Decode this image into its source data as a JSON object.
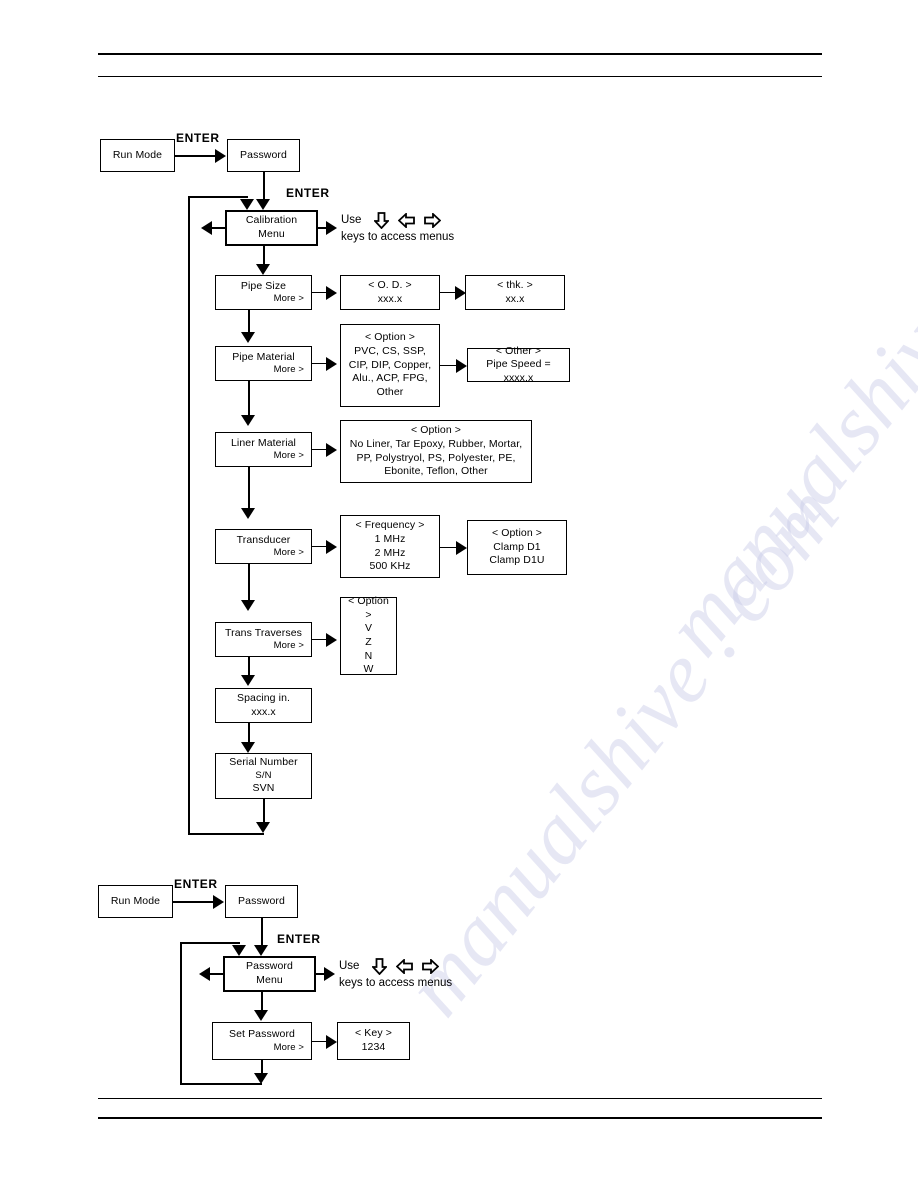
{
  "document": {
    "watermark_text": "manualshive . com"
  },
  "calibration_flow": {
    "run_mode": "Run Mode",
    "password": "Password",
    "enter_label_1": "ENTER",
    "enter_label_2": "ENTER",
    "menu_title_line1": "Calibration",
    "menu_title_line2": "Menu",
    "use_note_line1": "Use",
    "use_note_line2": "keys to access menus",
    "steps": {
      "pipe_size": {
        "label": "Pipe Size",
        "more": "More >"
      },
      "od": {
        "header": "< O. D. >",
        "value": "xxx.x"
      },
      "thk": {
        "header": "< thk. >",
        "value": "xx.x"
      },
      "pipe_material": {
        "label": "Pipe Material",
        "more": "More >"
      },
      "pipe_material_option": {
        "header": "< Option >",
        "line1": "PVC, CS, SSP,",
        "line2": "CIP, DIP, Copper,",
        "line3": "Alu., ACP, FPG,",
        "line4": "Other"
      },
      "pipe_other": {
        "header": "< Other >",
        "value": "Pipe Speed = xxxx.x"
      },
      "liner_material": {
        "label": "Liner Material",
        "more": "More >"
      },
      "liner_option": {
        "header": "< Option >",
        "line1": "No Liner, Tar Epoxy, Rubber, Mortar,",
        "line2": "PP, Polystryol, PS, Polyester, PE,",
        "line3": "Ebonite, Teflon, Other"
      },
      "transducer": {
        "label": "Transducer",
        "more": "More >"
      },
      "frequency": {
        "header": "< Frequency >",
        "line1": "1 MHz",
        "line2": "2 MHz",
        "line3": "500 KHz"
      },
      "clamp_option": {
        "header": "< Option >",
        "line1": "Clamp D1",
        "line2": "Clamp D1U"
      },
      "trans_traverses": {
        "label": "Trans Traverses",
        "more": "More >"
      },
      "traverse_option": {
        "header": "< Option >",
        "line1": "V",
        "line2": "Z",
        "line3": "N",
        "line4": "W"
      },
      "spacing": {
        "label": "Spacing in.",
        "value": "xxx.x"
      },
      "serial_number": {
        "label": "Serial Number",
        "line2": "S/N",
        "line3": "SVN"
      }
    }
  },
  "password_flow": {
    "run_mode": "Run Mode",
    "password": "Password",
    "enter_label_1": "ENTER",
    "enter_label_2": "ENTER",
    "menu_title_line1": "Password",
    "menu_title_line2": "Menu",
    "use_note_line1": "Use",
    "use_note_line2": "keys to access menus",
    "steps": {
      "set_password": {
        "label": "Set Password",
        "more": "More >"
      },
      "key": {
        "header": "< Key >",
        "value": "1234"
      }
    }
  },
  "icons": {
    "arrow_down": "arrow-down-outline-icon",
    "arrow_left": "arrow-left-outline-icon",
    "arrow_right": "arrow-right-outline-icon"
  }
}
